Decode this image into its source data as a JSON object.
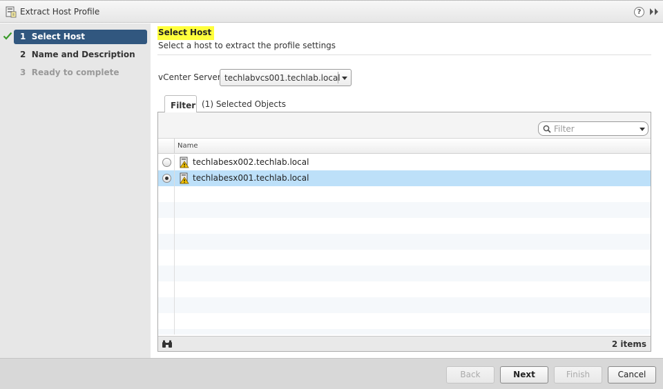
{
  "window": {
    "title": "Extract Host Profile"
  },
  "steps": [
    {
      "number": "1",
      "label": "Select Host",
      "state": "current"
    },
    {
      "number": "2",
      "label": "Name and Description",
      "state": "pending"
    },
    {
      "number": "3",
      "label": "Ready to complete",
      "state": "disabled"
    }
  ],
  "main": {
    "title": "Select Host",
    "subtitle": "Select a host to extract the profile settings",
    "vcenter": {
      "label": "vCenter Server:",
      "value": "techlabvcs001.techlab.local"
    },
    "tabs": [
      {
        "label": "Filter",
        "active": true
      },
      {
        "label": "(1) Selected Objects",
        "active": false
      }
    ],
    "filter": {
      "placeholder": "Filter"
    },
    "grid": {
      "column": "Name",
      "rows": [
        {
          "name": "techlabesx002.techlab.local",
          "selected": false
        },
        {
          "name": "techlabesx001.techlab.local",
          "selected": true
        }
      ],
      "count": "2 items"
    }
  },
  "buttons": {
    "back": "Back",
    "next": "Next",
    "finish": "Finish",
    "cancel": "Cancel"
  },
  "colors": {
    "step_highlight": "#31577f",
    "title_highlight": "#ffff3c",
    "row_selected": "#bde0f9",
    "check": "#3a9a2a",
    "warning": "#f2c200"
  }
}
